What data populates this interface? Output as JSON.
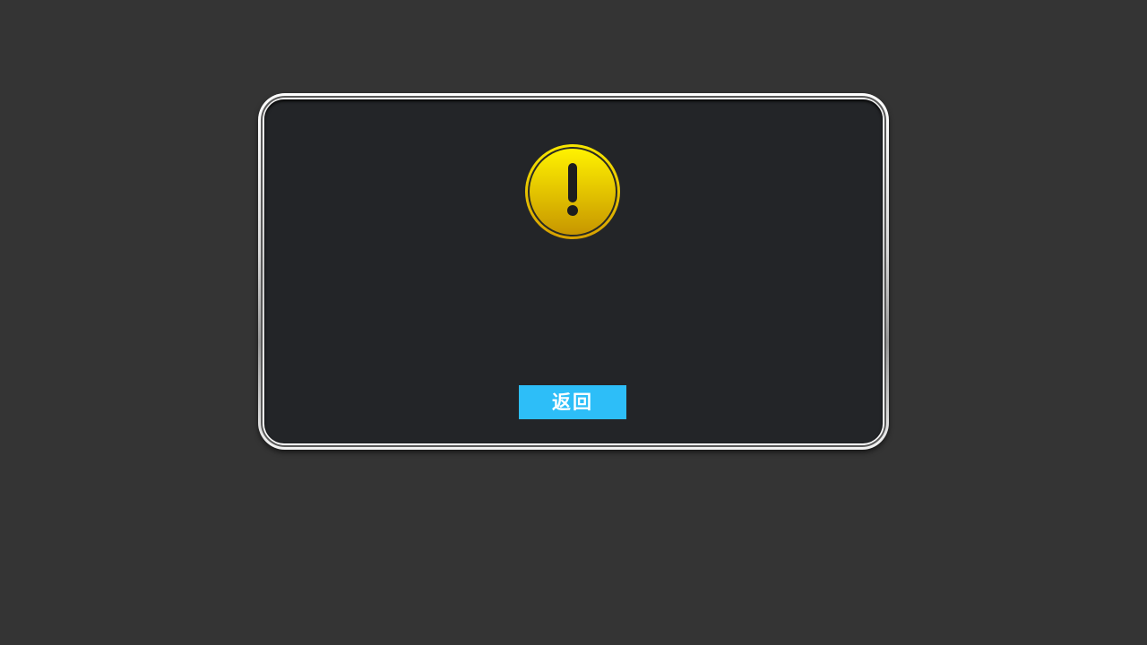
{
  "dialog": {
    "icon": "warning-exclamation-icon",
    "icon_color": "#f2e600",
    "icon_color_dark": "#c99a00",
    "back_button_label": "返回",
    "button_color": "#2dbef8",
    "panel_color": "#232528",
    "page_background": "#343434"
  }
}
